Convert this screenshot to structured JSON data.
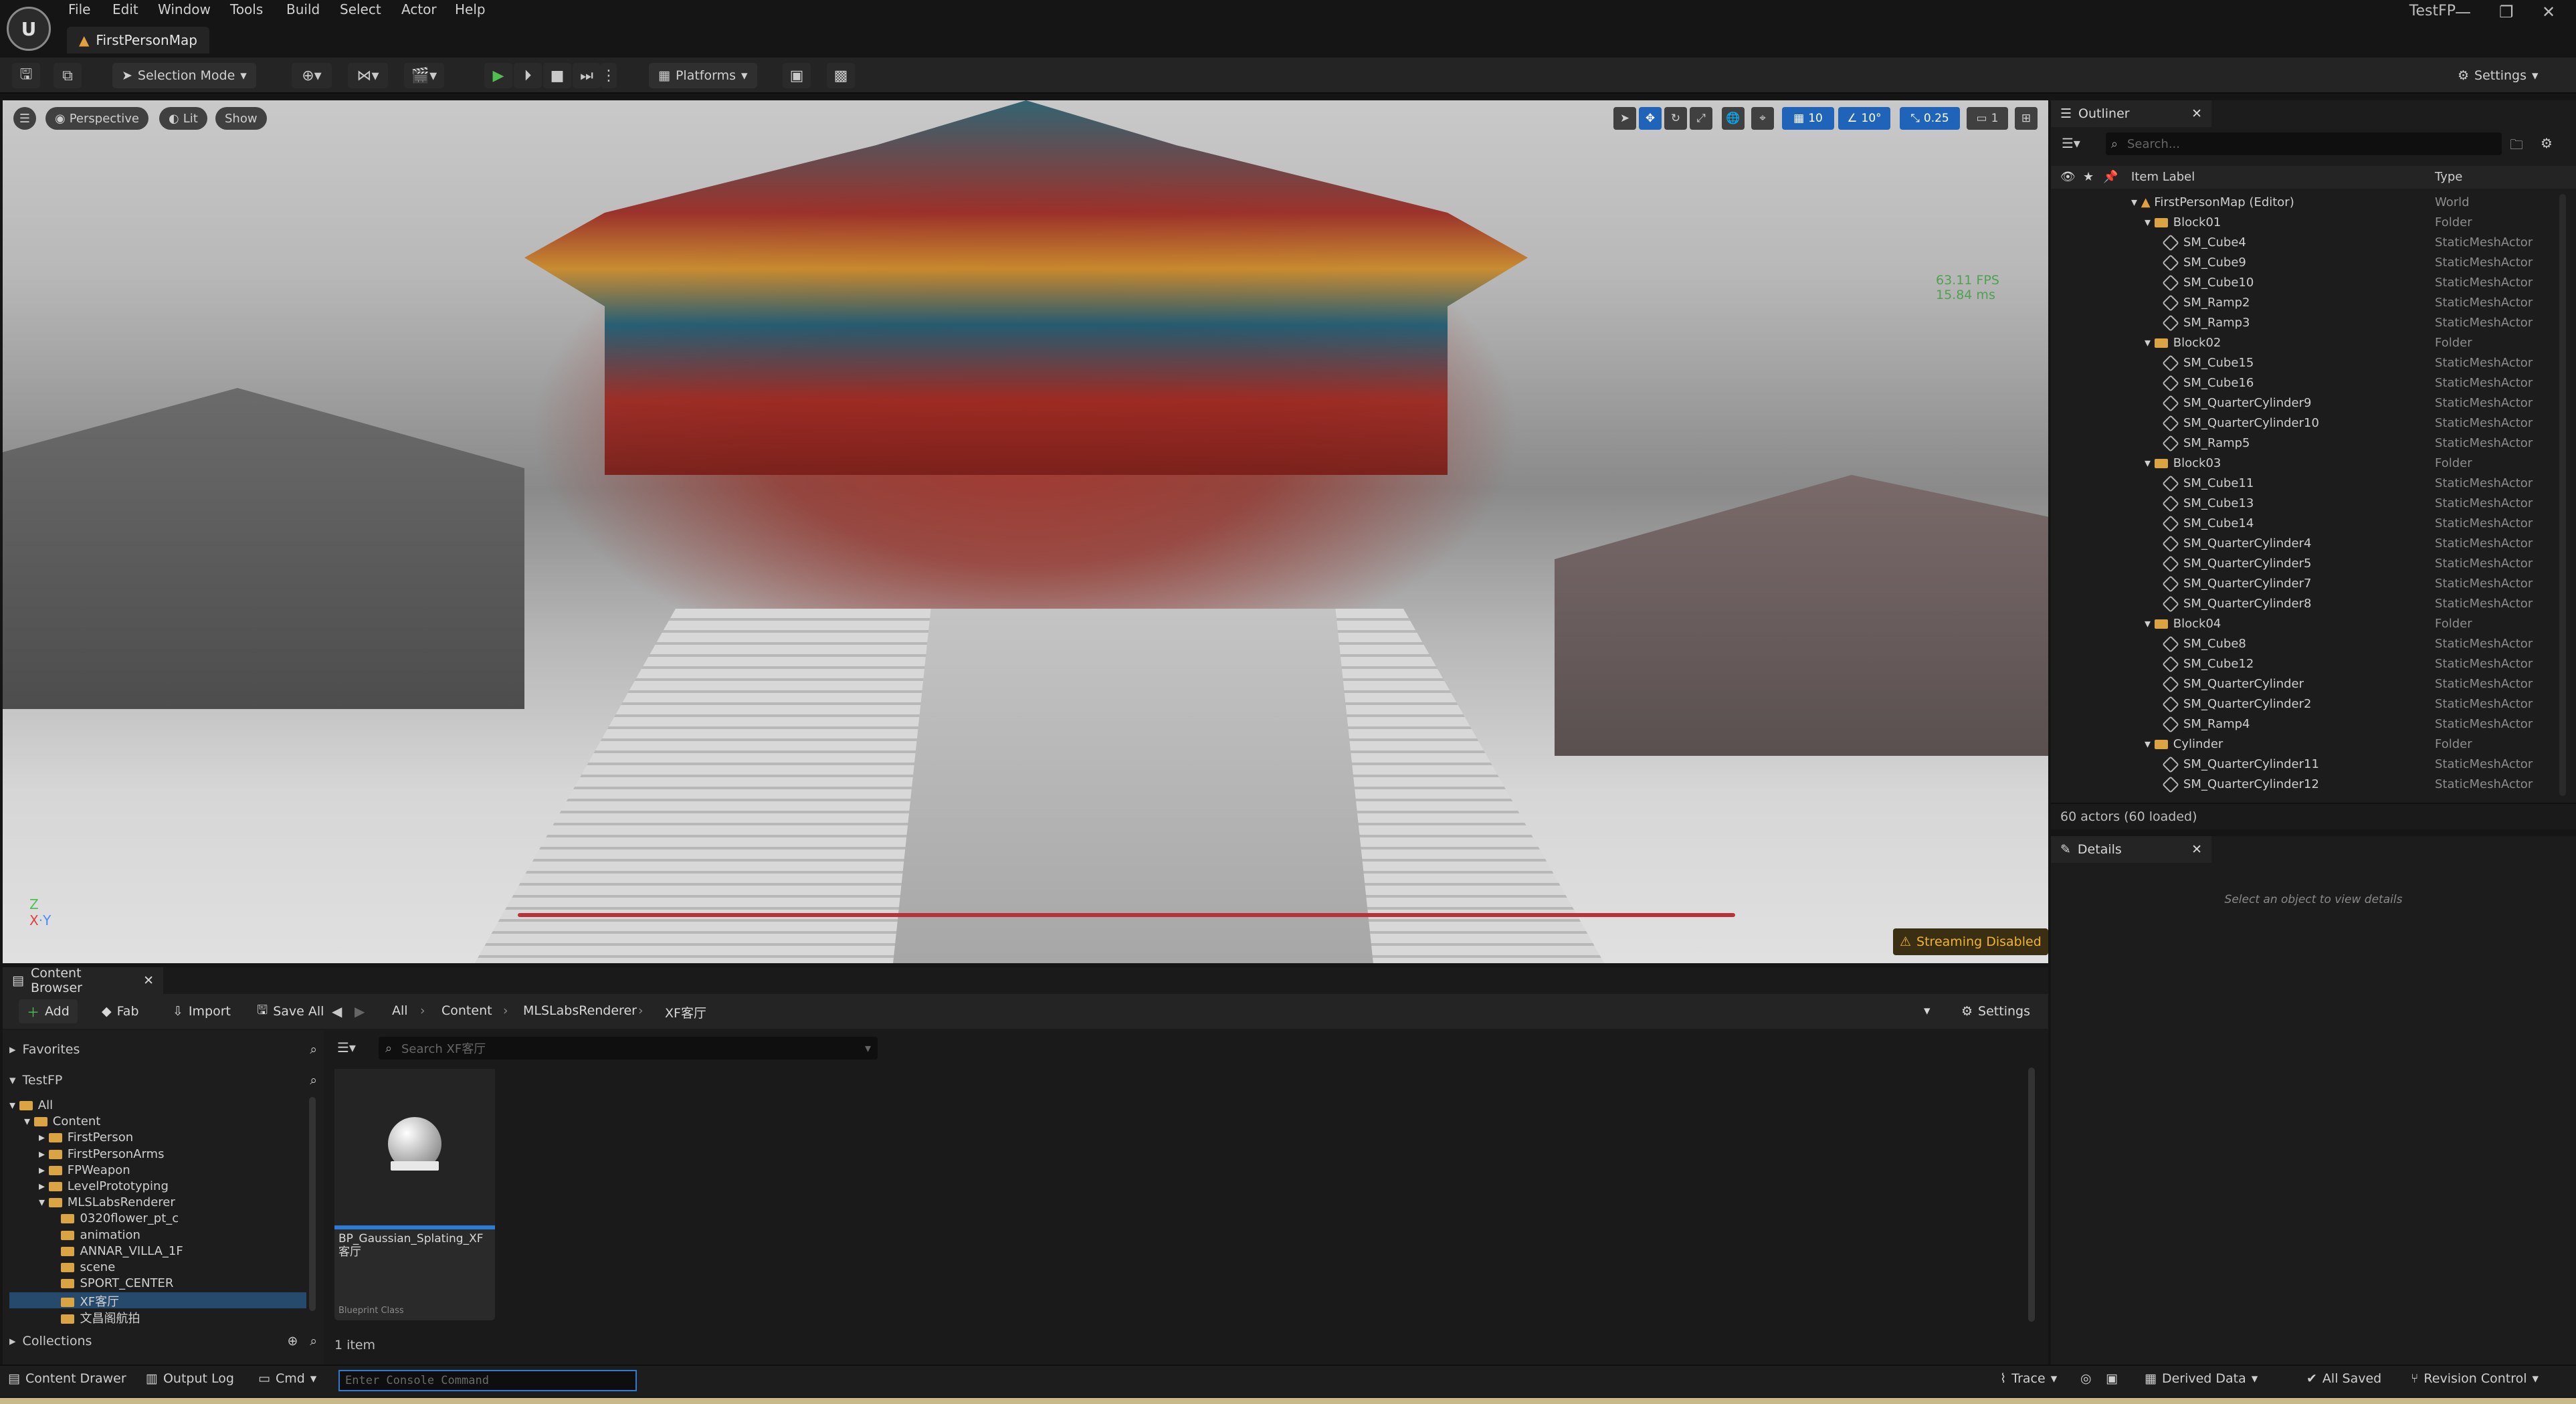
{
  "app": {
    "title": "TestFP",
    "map_tab": "FirstPersonMap"
  },
  "menu": [
    "File",
    "Edit",
    "Window",
    "Tools",
    "Build",
    "Select",
    "Actor",
    "Help"
  ],
  "toolbar": {
    "selection_mode": "Selection Mode",
    "platforms": "Platforms",
    "settings": "Settings"
  },
  "viewport": {
    "perspective": "Perspective",
    "lit": "Lit",
    "show": "Show",
    "grid_snap": "10",
    "rot_snap": "10°",
    "scale_snap": "0.25",
    "camera_speed": "1",
    "fps": "63.11 FPS",
    "ms": "15.84 ms",
    "streaming": "Streaming Disabled"
  },
  "outliner": {
    "tab": "Outliner",
    "search_placeholder": "Search...",
    "col_label": "Item Label",
    "col_type": "Type",
    "rows": [
      {
        "label": "FirstPersonMap (Editor)",
        "type": "World",
        "kind": "world"
      },
      {
        "label": "Block01",
        "type": "Folder",
        "kind": "folder"
      },
      {
        "label": "SM_Cube4",
        "type": "StaticMeshActor",
        "kind": "mesh"
      },
      {
        "label": "SM_Cube9",
        "type": "StaticMeshActor",
        "kind": "mesh"
      },
      {
        "label": "SM_Cube10",
        "type": "StaticMeshActor",
        "kind": "mesh"
      },
      {
        "label": "SM_Ramp2",
        "type": "StaticMeshActor",
        "kind": "mesh"
      },
      {
        "label": "SM_Ramp3",
        "type": "StaticMeshActor",
        "kind": "mesh"
      },
      {
        "label": "Block02",
        "type": "Folder",
        "kind": "folder"
      },
      {
        "label": "SM_Cube15",
        "type": "StaticMeshActor",
        "kind": "mesh"
      },
      {
        "label": "SM_Cube16",
        "type": "StaticMeshActor",
        "kind": "mesh"
      },
      {
        "label": "SM_QuarterCylinder9",
        "type": "StaticMeshActor",
        "kind": "mesh"
      },
      {
        "label": "SM_QuarterCylinder10",
        "type": "StaticMeshActor",
        "kind": "mesh"
      },
      {
        "label": "SM_Ramp5",
        "type": "StaticMeshActor",
        "kind": "mesh"
      },
      {
        "label": "Block03",
        "type": "Folder",
        "kind": "folder"
      },
      {
        "label": "SM_Cube11",
        "type": "StaticMeshActor",
        "kind": "mesh"
      },
      {
        "label": "SM_Cube13",
        "type": "StaticMeshActor",
        "kind": "mesh"
      },
      {
        "label": "SM_Cube14",
        "type": "StaticMeshActor",
        "kind": "mesh"
      },
      {
        "label": "SM_QuarterCylinder4",
        "type": "StaticMeshActor",
        "kind": "mesh"
      },
      {
        "label": "SM_QuarterCylinder5",
        "type": "StaticMeshActor",
        "kind": "mesh"
      },
      {
        "label": "SM_QuarterCylinder7",
        "type": "StaticMeshActor",
        "kind": "mesh"
      },
      {
        "label": "SM_QuarterCylinder8",
        "type": "StaticMeshActor",
        "kind": "mesh"
      },
      {
        "label": "Block04",
        "type": "Folder",
        "kind": "folder"
      },
      {
        "label": "SM_Cube8",
        "type": "StaticMeshActor",
        "kind": "mesh"
      },
      {
        "label": "SM_Cube12",
        "type": "StaticMeshActor",
        "kind": "mesh"
      },
      {
        "label": "SM_QuarterCylinder",
        "type": "StaticMeshActor",
        "kind": "mesh"
      },
      {
        "label": "SM_QuarterCylinder2",
        "type": "StaticMeshActor",
        "kind": "mesh"
      },
      {
        "label": "SM_Ramp4",
        "type": "StaticMeshActor",
        "kind": "mesh"
      },
      {
        "label": "Cylinder",
        "type": "Folder",
        "kind": "folder"
      },
      {
        "label": "SM_QuarterCylinder11",
        "type": "StaticMeshActor",
        "kind": "mesh"
      },
      {
        "label": "SM_QuarterCylinder12",
        "type": "StaticMeshActor",
        "kind": "mesh"
      }
    ],
    "count": "60 actors (60 loaded)"
  },
  "details": {
    "tab": "Details",
    "empty_msg": "Select an object to view details"
  },
  "content_browser": {
    "tab": "Content Browser",
    "add": "Add",
    "fab": "Fab",
    "import": "Import",
    "save_all": "Save All",
    "settings": "Settings",
    "breadcrumb": [
      "All",
      "Content",
      "MLSLabsRenderer",
      "XF客厅"
    ],
    "favorites": "Favorites",
    "project": "TestFP",
    "collections": "Collections",
    "search_placeholder": "Search XF客厅",
    "tree": [
      {
        "label": "All",
        "depth": 0,
        "sel": false
      },
      {
        "label": "Content",
        "depth": 1,
        "sel": false
      },
      {
        "label": "FirstPerson",
        "depth": 2,
        "sel": false
      },
      {
        "label": "FirstPersonArms",
        "depth": 2,
        "sel": false
      },
      {
        "label": "FPWeapon",
        "depth": 2,
        "sel": false
      },
      {
        "label": "LevelPrototyping",
        "depth": 2,
        "sel": false
      },
      {
        "label": "MLSLabsRenderer",
        "depth": 2,
        "sel": false
      },
      {
        "label": "0320flower_pt_c",
        "depth": 3,
        "sel": false
      },
      {
        "label": "animation",
        "depth": 3,
        "sel": false
      },
      {
        "label": "ANNAR_VILLA_1F",
        "depth": 3,
        "sel": false
      },
      {
        "label": "scene",
        "depth": 3,
        "sel": false
      },
      {
        "label": "SPORT_CENTER",
        "depth": 3,
        "sel": false
      },
      {
        "label": "XF客厅",
        "depth": 3,
        "sel": true
      },
      {
        "label": "文昌阁航拍",
        "depth": 3,
        "sel": false
      }
    ],
    "asset_name": "BP_Gaussian_Splating_XF客厅",
    "asset_type": "Blueprint Class",
    "item_count": "1 item"
  },
  "statusbar": {
    "content_drawer": "Content Drawer",
    "output_log": "Output Log",
    "cmd": "Cmd",
    "console_placeholder": "Enter Console Command",
    "trace": "Trace",
    "derived_data": "Derived Data",
    "all_saved": "All Saved",
    "revision_control": "Revision Control"
  },
  "colors": {
    "accent": "#2e7bd6",
    "warning": "#f0b431",
    "fps": "#4fa14f",
    "folder": "#d9a441"
  }
}
